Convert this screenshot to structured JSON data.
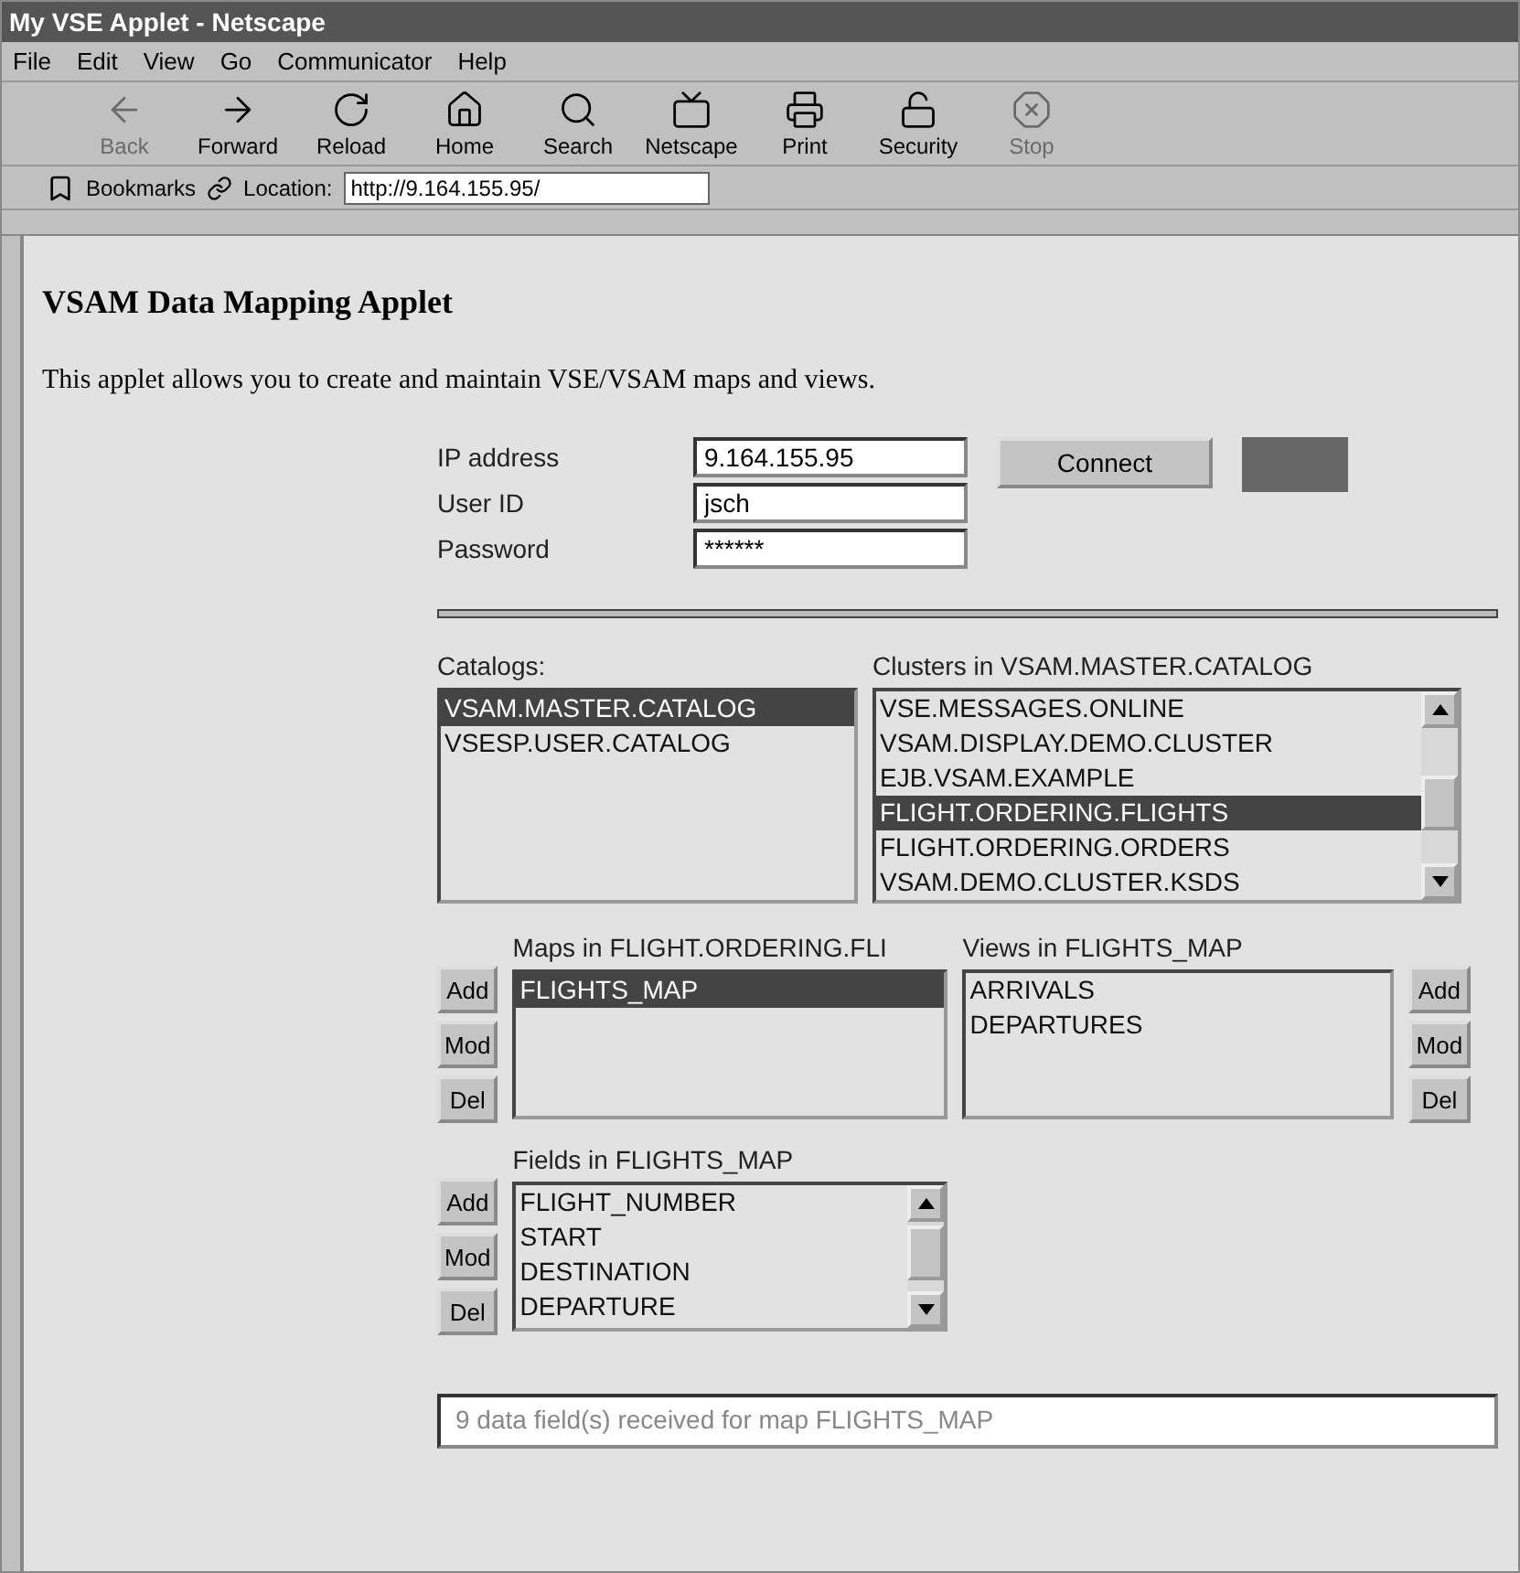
{
  "window": {
    "title": "My VSE Applet - Netscape"
  },
  "menu": [
    "File",
    "Edit",
    "View",
    "Go",
    "Communicator",
    "Help"
  ],
  "toolbar": [
    {
      "label": "Back",
      "kind": "back",
      "disabled": true
    },
    {
      "label": "Forward",
      "kind": "forward",
      "disabled": false
    },
    {
      "label": "Reload",
      "kind": "reload",
      "disabled": false
    },
    {
      "label": "Home",
      "kind": "home",
      "disabled": false
    },
    {
      "label": "Search",
      "kind": "search",
      "disabled": false
    },
    {
      "label": "Netscape",
      "kind": "portal",
      "disabled": false
    },
    {
      "label": "Print",
      "kind": "print",
      "disabled": false
    },
    {
      "label": "Security",
      "kind": "security",
      "disabled": false
    },
    {
      "label": "Stop",
      "kind": "stop",
      "disabled": true
    }
  ],
  "location_bar": {
    "bookmarks": "Bookmarks",
    "location_label": "Location:",
    "url": "http://9.164.155.95/"
  },
  "page": {
    "heading": "VSAM Data Mapping Applet",
    "intro": "This applet allows you to create and maintain VSE/VSAM maps and views.",
    "login": [
      {
        "label": "IP address",
        "value": "9.164.155.95"
      },
      {
        "label": "User ID",
        "value": "jsch"
      },
      {
        "label": "Password",
        "value": "******"
      }
    ],
    "connect_button": "Connect",
    "catalogs": {
      "label": "Catalogs:",
      "items": [
        {
          "text": "VSAM.MASTER.CATALOG",
          "selected": true
        },
        {
          "text": "VSESP.USER.CATALOG",
          "selected": false
        }
      ]
    },
    "clusters": {
      "label": "Clusters in VSAM.MASTER.CATALOG",
      "items": [
        {
          "text": "VSE.MESSAGES.ONLINE",
          "selected": false
        },
        {
          "text": "VSAM.DISPLAY.DEMO.CLUSTER",
          "selected": false
        },
        {
          "text": "EJB.VSAM.EXAMPLE",
          "selected": false
        },
        {
          "text": "FLIGHT.ORDERING.FLIGHTS",
          "selected": true
        },
        {
          "text": "FLIGHT.ORDERING.ORDERS",
          "selected": false
        },
        {
          "text": "VSAM.DEMO.CLUSTER.KSDS",
          "selected": false
        }
      ]
    },
    "maps": {
      "label": "Maps in FLIGHT.ORDERING.FLI",
      "buttons": [
        "Add",
        "Mod",
        "Del"
      ],
      "items": [
        {
          "text": "FLIGHTS_MAP",
          "selected": true
        }
      ]
    },
    "views": {
      "label": "Views in FLIGHTS_MAP",
      "buttons": [
        "Add",
        "Mod",
        "Del"
      ],
      "items": [
        {
          "text": "ARRIVALS",
          "selected": false
        },
        {
          "text": "DEPARTURES",
          "selected": false
        }
      ]
    },
    "fields": {
      "label": "Fields in FLIGHTS_MAP",
      "buttons": [
        "Add",
        "Mod",
        "Del"
      ],
      "items": [
        {
          "text": "FLIGHT_NUMBER",
          "selected": false
        },
        {
          "text": "START",
          "selected": false
        },
        {
          "text": "DESTINATION",
          "selected": false
        },
        {
          "text": "DEPARTURE",
          "selected": false
        }
      ]
    },
    "status": "9 data field(s) received for map FLIGHTS_MAP"
  }
}
